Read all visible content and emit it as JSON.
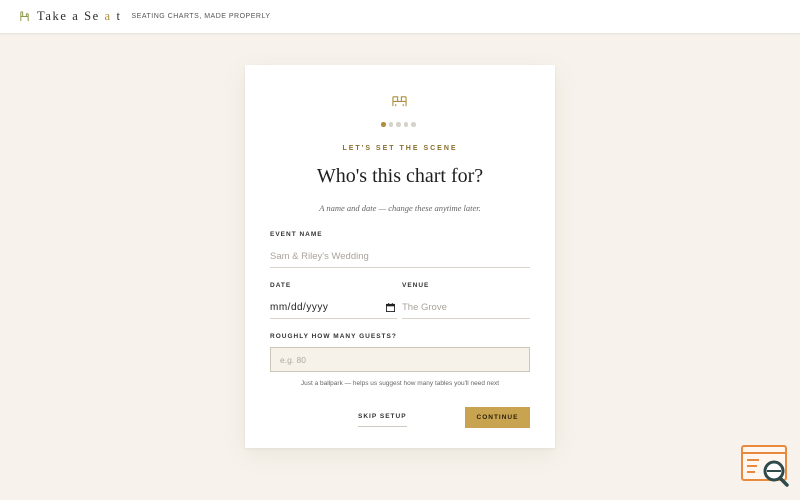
{
  "header": {
    "brand_pre": "Take a Se",
    "brand_accent": "a",
    "brand_post": "t",
    "tagline": "Seating Charts, Made Properly"
  },
  "card": {
    "step": {
      "current": 1,
      "total": 5
    },
    "eyebrow": "Let's Set the Scene",
    "title": "Who's this chart for?",
    "subtitle": "A name and date — change these anytime later.",
    "event_name": {
      "label": "Event Name",
      "placeholder": "Sam & Riley's Wedding",
      "value": ""
    },
    "date": {
      "label": "Date",
      "value": "mm/dd/yyyy"
    },
    "venue": {
      "label": "Venue",
      "placeholder": "The Grove",
      "value": ""
    },
    "guests": {
      "label": "Roughly How Many Guests?",
      "placeholder": "e.g. 80",
      "value": ""
    },
    "hint": "Just a ballpark — helps us suggest how many tables you'll need next",
    "skip_label": "Skip Setup",
    "continue_label": "Continue"
  },
  "colors": {
    "accent": "#c8a451",
    "accent_dark": "#8a6d2a",
    "background": "#f7f3ec"
  }
}
